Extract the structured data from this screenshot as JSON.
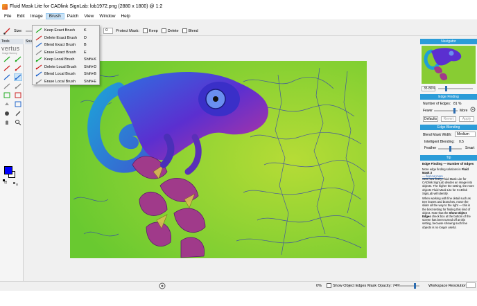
{
  "window": {
    "title": "Fluid Mask Lite for CADlink SignLab: lob1972.png (2880 x 1800) @ 1:2"
  },
  "menubar": {
    "items": [
      "File",
      "Edit",
      "Image",
      "Brush",
      "Patch",
      "View",
      "Window",
      "Help"
    ],
    "active": "Brush"
  },
  "toolbar": {
    "size_label": "Size:",
    "value": "0",
    "protect_mask_label": "Protect Mask:",
    "keep_label": "Keep",
    "delete_label": "Delete",
    "blend_label": "Blend"
  },
  "tools_panel": {
    "tab_label": "Tools",
    "logo": "vertus",
    "logo_sub": "image fluency",
    "source_tab": "Sour"
  },
  "brush_menu": {
    "items": [
      {
        "label": "Keep Exact Brush",
        "shortcut": "K",
        "icon": "keep-exact-brush-icon"
      },
      {
        "label": "Delete Exact Brush",
        "shortcut": "D",
        "icon": "delete-exact-brush-icon"
      },
      {
        "label": "Blend Exact Brush",
        "shortcut": "B",
        "icon": "blend-exact-brush-icon"
      },
      {
        "label": "Erase Exact Brush",
        "shortcut": "E",
        "icon": "erase-exact-brush-icon"
      },
      {
        "label": "Keep Local Brush",
        "shortcut": "Shift+K",
        "icon": "keep-local-brush-icon"
      },
      {
        "label": "Delete Local Brush",
        "shortcut": "Shift+D",
        "icon": "delete-local-brush-icon"
      },
      {
        "label": "Blend Local Brush",
        "shortcut": "Shift+B",
        "icon": "blend-local-brush-icon"
      },
      {
        "label": "Erase Local Brush",
        "shortcut": "Shift+E",
        "icon": "erase-local-brush-icon"
      }
    ]
  },
  "navigator": {
    "header": "Navigator",
    "zoom": "35.86%"
  },
  "edge_finding": {
    "header": "Edge Finding",
    "number_label": "Number of Edges:",
    "number_value": "81 %",
    "fewer": "Fewer",
    "more": "More",
    "defaults": "Defaults",
    "revert": "Revert",
    "apply": "Apply"
  },
  "edge_blending": {
    "header": "Edge Blending",
    "width_label": "Blend Mask Width:",
    "width_value": "Medium",
    "intelligent_label": "Intelligent Blending:",
    "intelligent_value": "0.5",
    "feather": "Feather",
    "smart": "Smart"
  },
  "tip": {
    "header": "Tip",
    "title": "Edge Finding — Number of Edges",
    "p1": "More edge finding solutions in ",
    "p1_bold": "Fluid Mask 3",
    "p1_link": "— find out more",
    "p2": "Sets how finely Fluid Mask Lite for CADlink SignLab divides an image into objects. The higher the setting, the more objects Fluid Mask Lite for CADlink SignLab will identify.",
    "p3": "When working with fine detail such as tree leaves and branches, move the slider all the way to the right — this is the best setting for finding this kind of object. Note that the ",
    "p3_bold": "Show Object Edges",
    "p3_end": " check box at the bottom of the screen has been turned off at this setting, because showing such fine objects is no longer useful."
  },
  "status": {
    "percent": "0%",
    "show_edges": "Show Object Edges",
    "opacity": "Mask Opacity: 74%",
    "workspace": "Workspace Resolution:"
  },
  "colors": {
    "accent": "#2b9cd8",
    "foreground": "#0000ff",
    "background": "#ffffff"
  }
}
